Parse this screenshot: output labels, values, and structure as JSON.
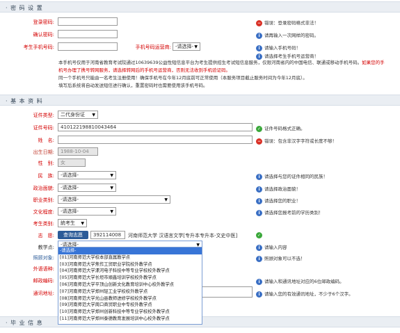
{
  "password_section": {
    "title": "· 密 码 设 置",
    "password_label": "登录密码:",
    "confirm_label": "确认密码:",
    "phone_label": "考生手机号码:",
    "carrier_label": "手机号码运营商:",
    "carrier_value": "-请选择-",
    "hints": {
      "password": "错误：登录密码格式非法！",
      "confirm": "请再输入一次网样的密码。",
      "phone": "请输入手机号码！",
      "carrier": "请选择考生手机号运营商！"
    },
    "notice_line1_a": "本手机号仅用于河南省教育考试院通过10639639公益性短信息平台为考生提供招生考试短信息服务，仅限河南省内的中国电信、联通或移动手机号码。",
    "notice_line1_b": "如果您的手",
    "notice_line2": "机号办理了携号转网服务，请选择转网后的手机号运营商，否则无法收到手机验证码。",
    "notice_line3": "同一个手机号只能由一名考生注册使用！确保手机号在今年12月底前可正常使用（本服务项目截止服务时间为今年12月底）。",
    "notice_line4": "填写后系统将自动发送短信进行确认，重置密码时也需要使用该手机号码。"
  },
  "basic_section": {
    "title": "· 基 本 资 料",
    "id_type_label": "证件类型:",
    "id_type_value": "二代身份证",
    "id_number_label": "证件号码:",
    "id_number_value": "410122198810043464",
    "name_label": "姓　名:",
    "birth_label": "出生日期:",
    "birth_value": "1988-10-04",
    "gender_label": "性　别:",
    "gender_value": "女",
    "nation_label": "民　族:",
    "nation_value": "-请选择-",
    "politics_label": "政治面貌:",
    "politics_value": "-请选择-",
    "career_label": "职业类别:",
    "career_value": "-请选择-",
    "education_label": "文化程度:",
    "education_value": "-请选择-",
    "examinee_type_label": "考生类别:",
    "examinee_type_value": "統考生",
    "wish_label": "志　愿:",
    "wish_button": "查询志愿",
    "wish_code": "392114008",
    "wish_text": "河南师范大学 汉语言文学[专升本专升本-文史中医]",
    "teaching_label": "教学点:",
    "teaching_value": "-请选择-",
    "exempt_label": "照顾对象:",
    "language_label": "外语语种:",
    "postcode_label": "邮政编码:",
    "address_label": "通讯地址:",
    "hints": {
      "id_number": "证件号码格式正确。",
      "name": "错误：包含非汉字字符或长度不够！",
      "nation": "请选择与您的证件相同的民族！",
      "politics": "请选择政治面貌！",
      "career": "请选择您的职业！",
      "education": "请选择您报考前的学历类别！",
      "teaching": "请输入内容",
      "exempt": "照顾对象可以不选！",
      "postcode": "请输入和通讯地址对应的6位邮政编码。",
      "address": "请输入您的有效通讯地址，不少于6个汉字。"
    }
  },
  "dropdown_options": [
    "-请选择-",
    "[01]河南师范大学校本部直属教学点",
    "[03]河南师范大学焦作工贸职业学院校外教学点",
    "[04]河南师范大学漯河电子科技中等专业学校校外教学点",
    "[05]河南师范大学长垣市顺鑫培训学校校外教学点",
    "[06]河南师范大学平顶山创新文化教育培训中心校外教学点",
    "[07]河南师范大学郑州轻工业学校校外教学点",
    "[08]河南师范大学光山县教师进修学校校外教学点",
    "[09]河南师范大学周口商贸职业中专校外教学点",
    "[10]河南师范大学郑州创新科技中等专业学校校外教学点",
    "[11]河南师范大学郑州泰德教育发展培训中心校外教学点"
  ],
  "graduate_section": {
    "title": "· 毕 业 信 息"
  },
  "colors": {
    "accent": "#2b5b98",
    "error": "#d93025",
    "info": "#3a6fc4",
    "ok": "#3aa83a",
    "section_bg": "#eaeef3"
  }
}
